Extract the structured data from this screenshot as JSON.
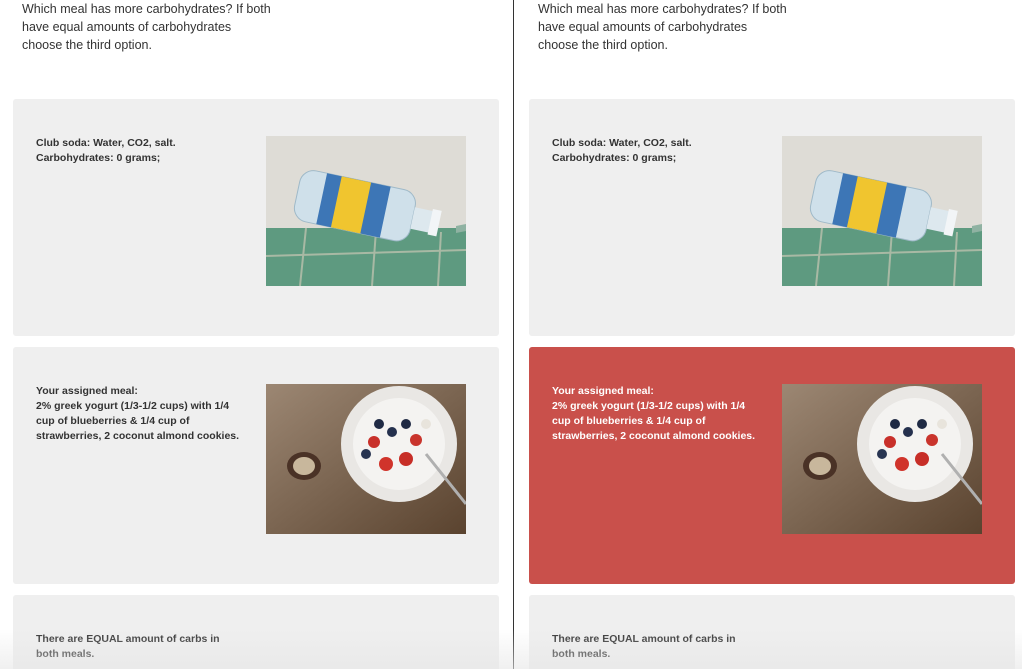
{
  "question": "Which meal has more carbohydrates? If both have equal amounts of carbohydrates choose the third option.",
  "options": {
    "club_soda": {
      "line1": "Club soda: Water, CO2, salt.",
      "line2": "Carbohydrates: 0 grams;"
    },
    "assigned_meal": {
      "line1": "Your assigned meal:",
      "line2": "2% greek yogurt (1/3-1/2 cups) with 1/4 cup of blueberries & 1/4 cup of strawberries, 2 coconut almond cookies."
    },
    "equal": {
      "text": "There are EQUAL amount of carbs in both meals."
    }
  },
  "colors": {
    "card_bg": "#efefef",
    "selected_bg": "#c9504b",
    "selected_text": "#ffffff"
  },
  "icons": {
    "photo_1": "club-soda-bottle-photo",
    "photo_2": "yogurt-berries-cookie-photo"
  }
}
